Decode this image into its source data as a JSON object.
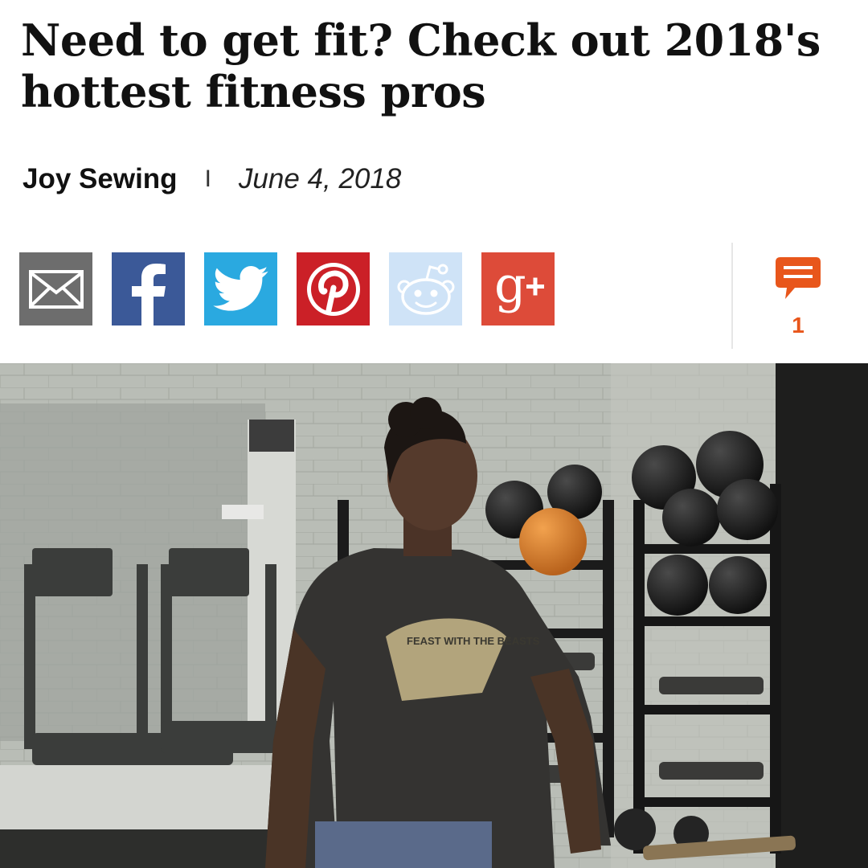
{
  "article": {
    "headline": "Need to get fit? Check out 2018's hottest fitness pros",
    "author": "Joy Sewing",
    "separator": "I",
    "date": "June 4, 2018"
  },
  "share_bar": {
    "buttons": [
      {
        "name": "email",
        "icon": "envelope-icon",
        "color": "#6d6d6d"
      },
      {
        "name": "facebook",
        "icon": "facebook-icon",
        "color": "#3b5998"
      },
      {
        "name": "twitter",
        "icon": "twitter-bird-icon",
        "color": "#2aa9e0"
      },
      {
        "name": "pinterest",
        "icon": "pinterest-icon",
        "color": "#cb2027"
      },
      {
        "name": "reddit",
        "icon": "reddit-alien-icon",
        "color": "#cfe3f7"
      },
      {
        "name": "google-plus",
        "icon": "google-plus-icon",
        "color": "#dd4b39"
      }
    ]
  },
  "comments": {
    "count": "1",
    "icon": "comment-bubble-icon",
    "color": "#e8561b"
  },
  "hero_image": {
    "icon": "gym-photo",
    "shirt_print": "FEAST WITH THE BEASTS"
  }
}
